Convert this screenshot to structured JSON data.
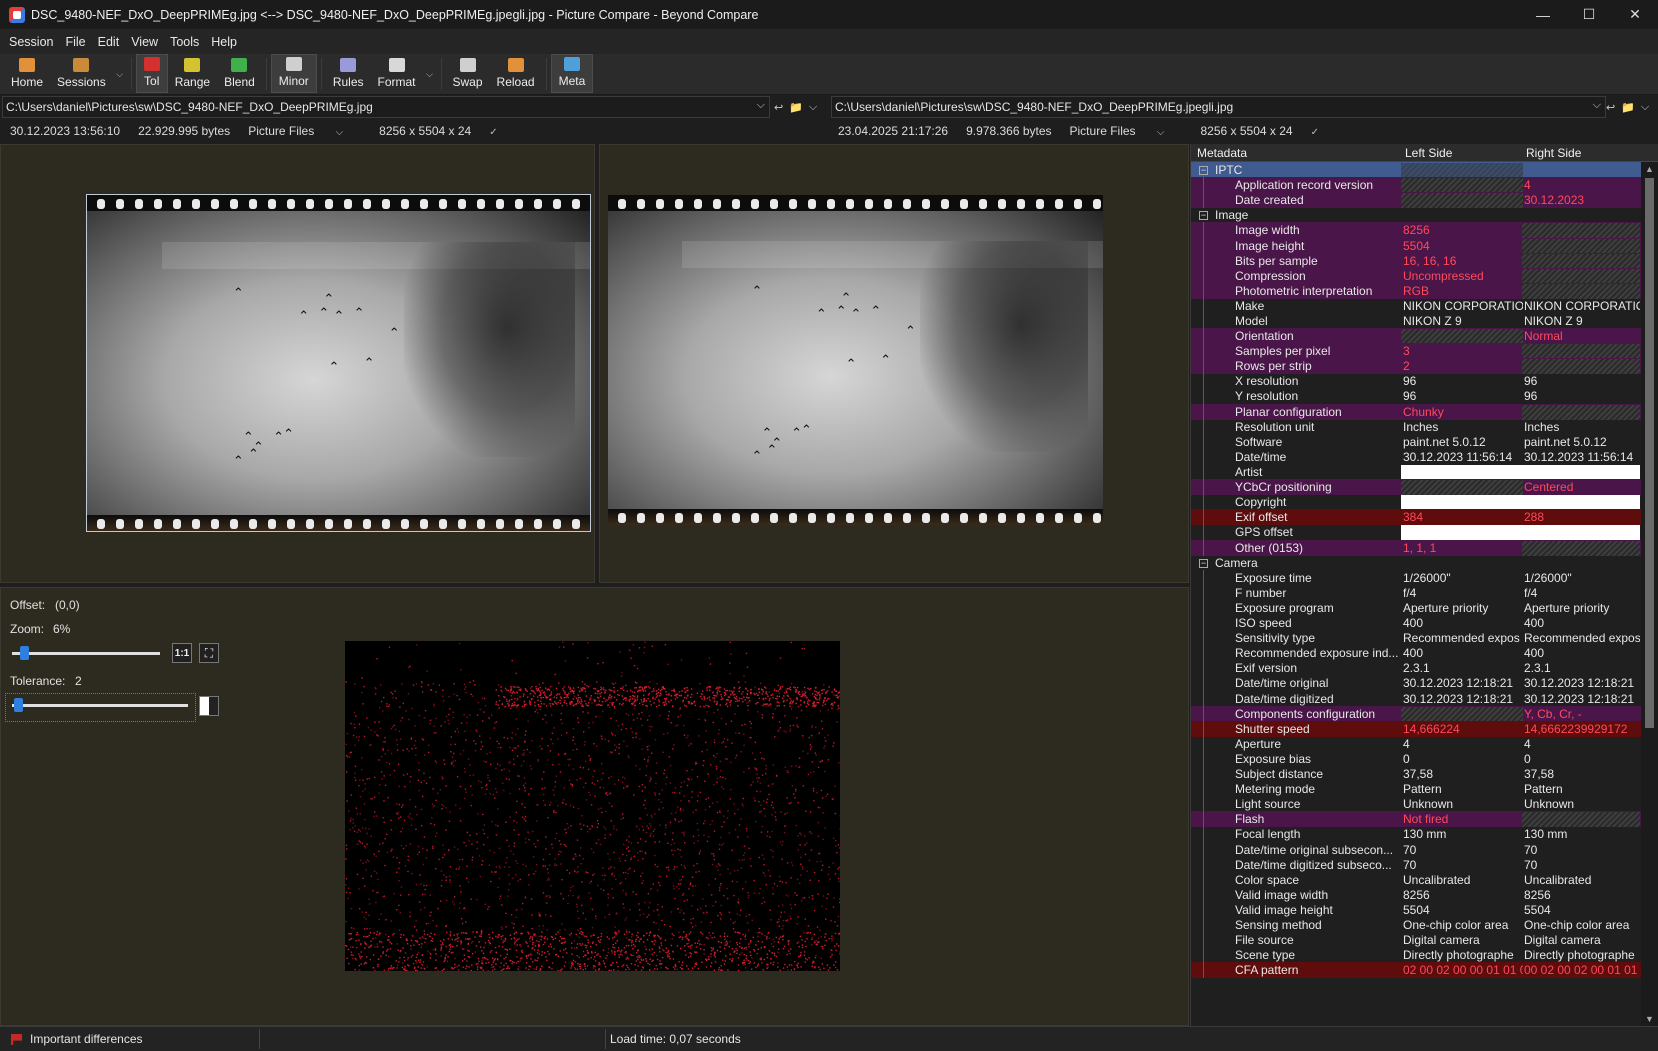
{
  "window": {
    "title": "DSC_9480-NEF_DxO_DeepPRIMEg.jpg <--> DSC_9480-NEF_DxO_DeepPRIMEg.jpegli.jpg - Picture Compare - Beyond Compare",
    "controls": {
      "minimize": "—",
      "maximize": "☐",
      "close": "✕"
    }
  },
  "menu": [
    "Session",
    "File",
    "Edit",
    "View",
    "Tools",
    "Help"
  ],
  "toolbar": [
    {
      "label": "Home",
      "icon": "home-icon",
      "color": "#e0913a"
    },
    {
      "label": "Sessions",
      "icon": "sessions-icon",
      "color": "#c98a3a",
      "dropdown": true
    },
    {
      "label": "Tol",
      "icon": "tolerance-icon",
      "color": "#d43030",
      "active": true
    },
    {
      "label": "Range",
      "icon": "range-icon",
      "color": "#d4c330"
    },
    {
      "label": "Blend",
      "icon": "blend-icon",
      "color": "#3fb04a"
    },
    {
      "label": "Minor",
      "icon": "minor-icon",
      "color": "#cfcfcf",
      "active": true
    },
    {
      "label": "Rules",
      "icon": "rules-icon",
      "color": "#9a9ad8"
    },
    {
      "label": "Format",
      "icon": "format-icon",
      "color": "#d8d8d8",
      "dropdown": true
    },
    {
      "label": "Swap",
      "icon": "swap-icon",
      "color": "#cfcfcf"
    },
    {
      "label": "Reload",
      "icon": "reload-icon",
      "color": "#e0913a"
    },
    {
      "label": "Meta",
      "icon": "meta-icon",
      "color": "#4fa0d8",
      "active": true
    }
  ],
  "left": {
    "path": "C:\\Users\\daniel\\Pictures\\sw\\DSC_9480-NEF_DxO_DeepPRIMEg.jpg",
    "date": "30.12.2023 13:56:10",
    "size": "22.929.995 bytes",
    "filetype": "Picture Files",
    "dimensions": "8256 x 5504 x 24"
  },
  "right": {
    "path": "C:\\Users\\daniel\\Pictures\\sw\\DSC_9480-NEF_DxO_DeepPRIMEg.jpegli.jpg",
    "date": "23.04.2025 21:17:26",
    "size": "9.978.366 bytes",
    "filetype": "Picture Files",
    "dimensions": "8256 x 5504 x 24"
  },
  "controls": {
    "offset_label": "Offset:",
    "offset_value": "(0,0)",
    "zoom_label": "Zoom:",
    "zoom_value": "6%",
    "zoom_level": 0.06,
    "one_to_one": "1:1",
    "tolerance_label": "Tolerance:",
    "tolerance_value": "2",
    "tolerance_level": 0.01
  },
  "metadata": {
    "columns": [
      "Metadata",
      "Left Side",
      "Right Side"
    ],
    "rows": [
      {
        "section": "IPTC"
      },
      {
        "name": "Application record version",
        "left": "",
        "right": "4",
        "diff": "purple",
        "lh": true,
        "rh": false
      },
      {
        "name": "Date created",
        "left": "",
        "right": "30.12.2023",
        "diff": "purple",
        "lh": true,
        "rh": false
      },
      {
        "section": "Image"
      },
      {
        "name": "Image width",
        "left": "8256",
        "right": "",
        "diff": "purple",
        "lh": false,
        "rh": true
      },
      {
        "name": "Image height",
        "left": "5504",
        "right": "",
        "diff": "purple",
        "lh": false,
        "rh": true
      },
      {
        "name": "Bits per sample",
        "left": "16, 16, 16",
        "right": "",
        "diff": "purple",
        "lh": false,
        "rh": true
      },
      {
        "name": "Compression",
        "left": "Uncompressed",
        "right": "",
        "diff": "purple",
        "lh": false,
        "rh": true
      },
      {
        "name": "Photometric interpretation",
        "left": "RGB",
        "right": "",
        "diff": "purple",
        "lh": false,
        "rh": true
      },
      {
        "name": "Make",
        "left": "NIKON CORPORATIO",
        "right": "NIKON CORPORATIO",
        "diff": "none"
      },
      {
        "name": "Model",
        "left": "NIKON Z 9",
        "right": "NIKON Z 9",
        "diff": "none"
      },
      {
        "name": "Orientation",
        "left": "",
        "right": "Normal",
        "diff": "purple",
        "lh": true,
        "rh": false
      },
      {
        "name": "Samples per pixel",
        "left": "3",
        "right": "",
        "diff": "purple",
        "lh": false,
        "rh": true
      },
      {
        "name": "Rows per strip",
        "left": "2",
        "right": "",
        "diff": "purple",
        "lh": false,
        "rh": true
      },
      {
        "name": "X resolution",
        "left": "96",
        "right": "96",
        "diff": "none"
      },
      {
        "name": "Y resolution",
        "left": "96",
        "right": "96",
        "diff": "none"
      },
      {
        "name": "Planar configuration",
        "left": "Chunky",
        "right": "",
        "diff": "purple",
        "lh": false,
        "rh": true
      },
      {
        "name": "Resolution unit",
        "left": "Inches",
        "right": "Inches",
        "diff": "none"
      },
      {
        "name": "Software",
        "left": "paint.net 5.0.12",
        "right": "paint.net 5.0.12",
        "diff": "none"
      },
      {
        "name": "Date/time",
        "left": "30.12.2023 11:56:14",
        "right": "30.12.2023 11:56:14",
        "diff": "none"
      },
      {
        "name": "Artist",
        "left": "",
        "right": "",
        "diff": "white"
      },
      {
        "name": "YCbCr positioning",
        "left": "",
        "right": "Centered",
        "diff": "purple",
        "lh": true,
        "rh": false
      },
      {
        "name": "Copyright",
        "left": "",
        "right": "",
        "diff": "white"
      },
      {
        "name": "Exif offset",
        "left": "384",
        "right": "288",
        "diff": "red"
      },
      {
        "name": "GPS offset",
        "left": "",
        "right": "",
        "diff": "white"
      },
      {
        "name": "Other (0153)",
        "left": "1, 1, 1",
        "right": "",
        "diff": "purple",
        "lh": false,
        "rh": true
      },
      {
        "section": "Camera"
      },
      {
        "name": "Exposure time",
        "left": "1/26000\"",
        "right": "1/26000\"",
        "diff": "none"
      },
      {
        "name": "F number",
        "left": "f/4",
        "right": "f/4",
        "diff": "none"
      },
      {
        "name": "Exposure program",
        "left": "Aperture priority",
        "right": "Aperture priority",
        "diff": "none"
      },
      {
        "name": "ISO speed",
        "left": "400",
        "right": "400",
        "diff": "none"
      },
      {
        "name": "Sensitivity type",
        "left": "Recommended expos",
        "right": "Recommended expos",
        "diff": "none"
      },
      {
        "name": "Recommended exposure ind...",
        "left": "400",
        "right": "400",
        "diff": "none"
      },
      {
        "name": "Exif version",
        "left": "2.3.1",
        "right": "2.3.1",
        "diff": "none"
      },
      {
        "name": "Date/time original",
        "left": "30.12.2023 12:18:21",
        "right": "30.12.2023 12:18:21",
        "diff": "none"
      },
      {
        "name": "Date/time digitized",
        "left": "30.12.2023 12:18:21",
        "right": "30.12.2023 12:18:21",
        "diff": "none"
      },
      {
        "name": "Components configuration",
        "left": "",
        "right": "Y, Cb, Cr, -",
        "diff": "purple",
        "lh": true,
        "rh": false
      },
      {
        "name": "Shutter speed",
        "left": "14,666224",
        "right": "14,6662239929172",
        "diff": "red"
      },
      {
        "name": "Aperture",
        "left": "4",
        "right": "4",
        "diff": "none"
      },
      {
        "name": "Exposure bias",
        "left": "0",
        "right": "0",
        "diff": "none"
      },
      {
        "name": "Subject distance",
        "left": "37,58",
        "right": "37,58",
        "diff": "none"
      },
      {
        "name": "Metering mode",
        "left": "Pattern",
        "right": "Pattern",
        "diff": "none"
      },
      {
        "name": "Light source",
        "left": "Unknown",
        "right": "Unknown",
        "diff": "none"
      },
      {
        "name": "Flash",
        "left": "Not fired",
        "right": "",
        "diff": "purple",
        "lh": false,
        "rh": true
      },
      {
        "name": "Focal length",
        "left": "130 mm",
        "right": "130 mm",
        "diff": "none"
      },
      {
        "name": "Date/time original subsecon...",
        "left": "70",
        "right": "70",
        "diff": "none"
      },
      {
        "name": "Date/time digitized subseco...",
        "left": "70",
        "right": "70",
        "diff": "none"
      },
      {
        "name": "Color space",
        "left": "Uncalibrated",
        "right": "Uncalibrated",
        "diff": "none"
      },
      {
        "name": "Valid image width",
        "left": "8256",
        "right": "8256",
        "diff": "none"
      },
      {
        "name": "Valid image height",
        "left": "5504",
        "right": "5504",
        "diff": "none"
      },
      {
        "name": "Sensing method",
        "left": "One-chip color area",
        "right": "One-chip color area",
        "diff": "none"
      },
      {
        "name": "File source",
        "left": "Digital camera",
        "right": "Digital camera",
        "diff": "none"
      },
      {
        "name": "Scene type",
        "left": "Directly photographe",
        "right": "Directly photographe",
        "diff": "none"
      },
      {
        "name": "CFA pattern",
        "left": "02 00 02 00 00 01 01 0",
        "right": "00 02 00 02 00 01 01 0",
        "diff": "red"
      }
    ]
  },
  "colors": {
    "purple_row": "#4a1548",
    "red_row": "#5e0c0c",
    "diff_text": "#ff4a5a",
    "selected_section": "#3f5b8f",
    "accent": "#2f7fe0"
  },
  "status": {
    "filter": "Important differences",
    "load_time": "Load time: 0,07 seconds"
  }
}
